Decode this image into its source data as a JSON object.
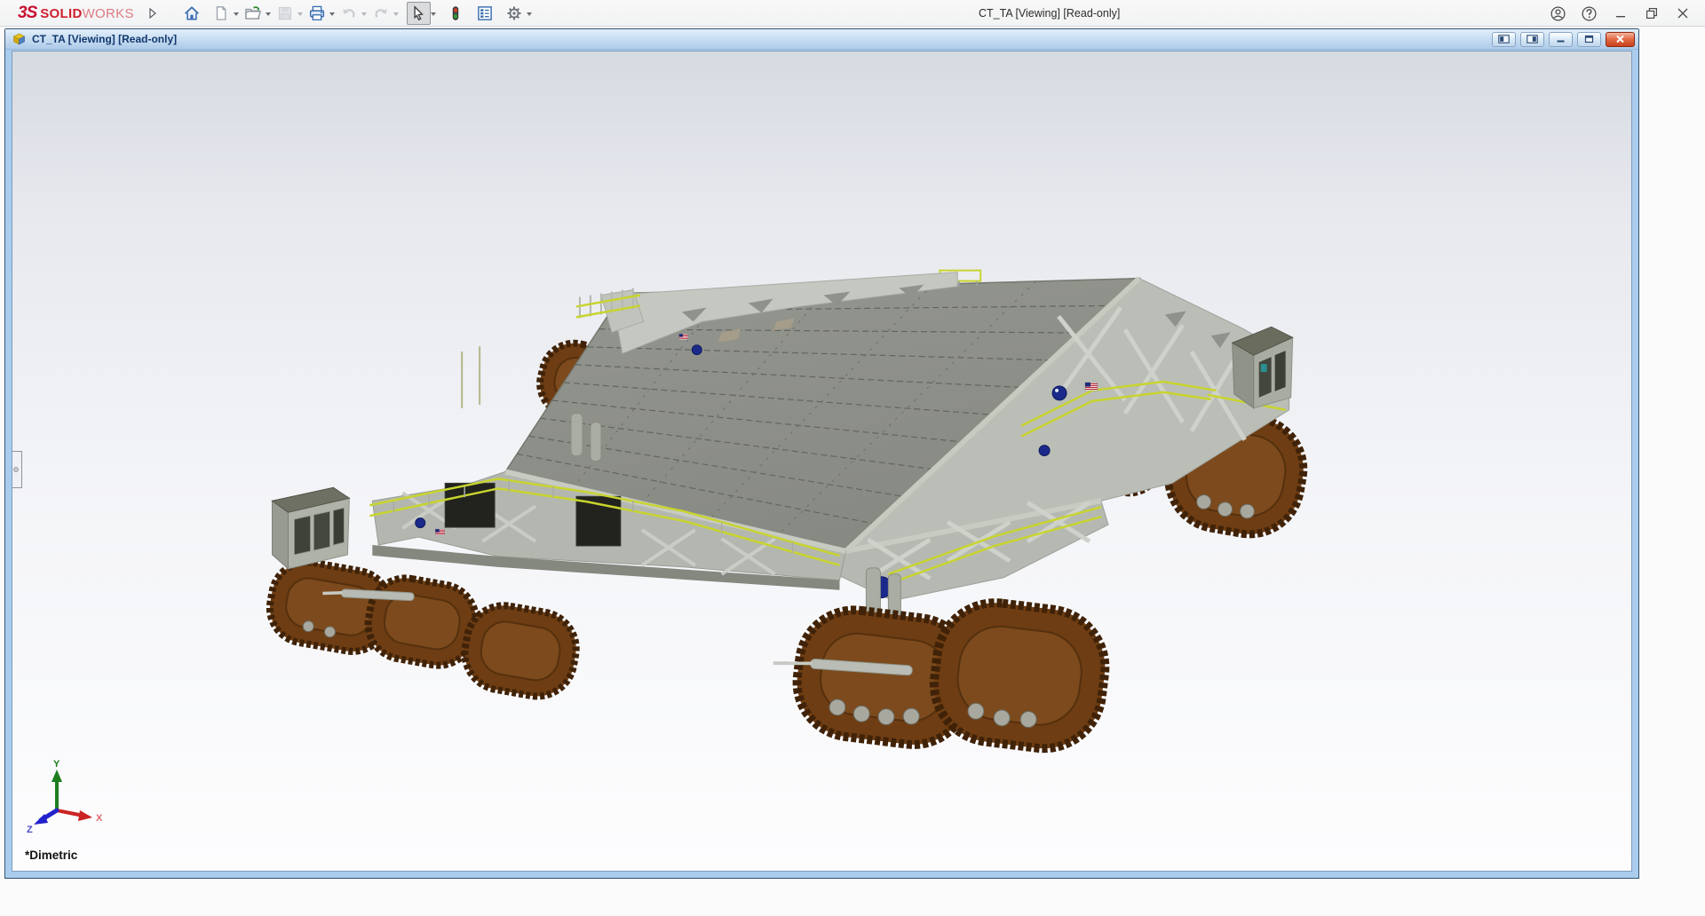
{
  "app": {
    "brand": {
      "mark": "3S",
      "name_bold": "SOLID",
      "name_light": "WORKS"
    },
    "title": "CT_TA [Viewing] [Read-only]",
    "toolbar_items": [
      {
        "name": "flyout-expander",
        "icon": "chevron-right-icon",
        "enabled": true
      },
      {
        "name": "home",
        "icon": "home-icon",
        "enabled": true
      },
      {
        "name": "new-document",
        "icon": "file-new-icon",
        "enabled": true,
        "dropdown": true
      },
      {
        "name": "open",
        "icon": "folder-open-icon",
        "enabled": true,
        "dropdown": true
      },
      {
        "name": "save",
        "icon": "floppy-icon",
        "enabled": false,
        "dropdown": true
      },
      {
        "name": "print",
        "icon": "printer-icon",
        "enabled": true,
        "dropdown": true
      },
      {
        "name": "undo",
        "icon": "undo-arrow-icon",
        "enabled": false,
        "dropdown": true
      },
      {
        "name": "redo",
        "icon": "redo-arrow-icon",
        "enabled": false,
        "dropdown": true
      },
      {
        "name": "select",
        "icon": "cursor-arrow-icon",
        "enabled": true,
        "active": true,
        "dropdown": true
      },
      {
        "name": "performance-stoplight",
        "icon": "stoplight-icon",
        "enabled": true
      },
      {
        "name": "task-pane-report",
        "icon": "report-icon",
        "enabled": true
      },
      {
        "name": "options",
        "icon": "gear-icon",
        "enabled": true,
        "dropdown": true
      }
    ],
    "window_controls": [
      "account",
      "help",
      "minimize",
      "restore",
      "close"
    ]
  },
  "document_window": {
    "title": "CT_TA [Viewing] [Read-only]",
    "controls": [
      "pane-split-left",
      "pane-split-right",
      "minimize",
      "restore",
      "close"
    ]
  },
  "viewport": {
    "view_orientation_label": "*Dimetric",
    "triad_labels": {
      "x": "X",
      "y": "Y",
      "z": "Z"
    },
    "model": {
      "subject": "crawler-transporter-assembly",
      "colors": {
        "deck": "#8d908a",
        "chassis": "#b5b9b1",
        "truss_highlight": "#cdd1c9",
        "tracks": "#6e3d13",
        "tracks_dark": "#3f2208",
        "railing_yellow": "#c8d42f",
        "nasa_logo_blue": "#1b2a8a",
        "flag_red": "#b22234",
        "cab_roof": "#6e7063",
        "grille_black": "#22231e"
      }
    }
  }
}
